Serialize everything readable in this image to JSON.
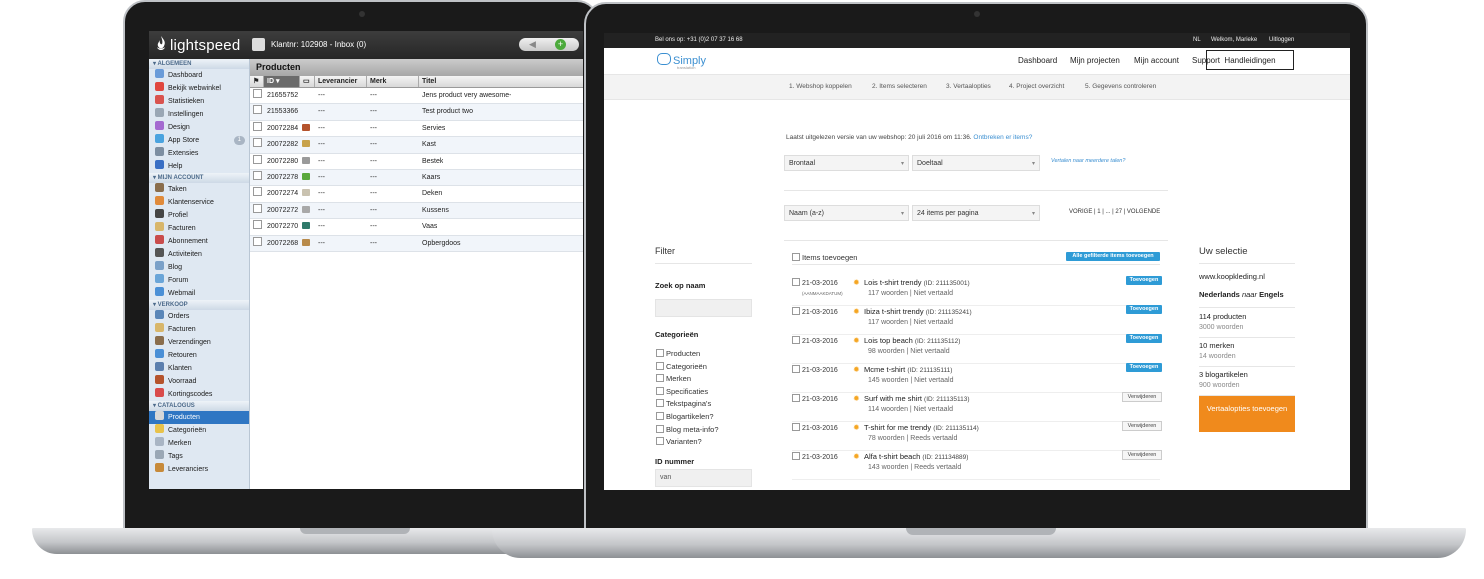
{
  "left": {
    "brand": "lightspeed",
    "client": "Klantnr: 102908 - Inbox (0)",
    "sections": [
      {
        "title": "ALGEMEEN",
        "items": [
          {
            "label": "Dashboard",
            "color": "#6a9bd8"
          },
          {
            "label": "Bekijk webwinkel",
            "color": "#e0473f"
          },
          {
            "label": "Statistieken",
            "color": "#d9534f"
          },
          {
            "label": "Instellingen",
            "color": "#9aa7b5"
          },
          {
            "label": "Design",
            "color": "#a46ad0"
          },
          {
            "label": "App Store",
            "color": "#4aa3df",
            "badge": "1"
          },
          {
            "label": "Extensies",
            "color": "#7d8ea1"
          },
          {
            "label": "Help",
            "color": "#3a6fc4"
          }
        ]
      },
      {
        "title": "MIJN ACCOUNT",
        "items": [
          {
            "label": "Taken",
            "color": "#8a6d4c"
          },
          {
            "label": "Klantenservice",
            "color": "#e08a3a"
          },
          {
            "label": "Profiel",
            "color": "#444444"
          },
          {
            "label": "Facturen",
            "color": "#d8b66a"
          },
          {
            "label": "Abonnement",
            "color": "#c94c4c"
          },
          {
            "label": "Activiteiten",
            "color": "#555555"
          },
          {
            "label": "Blog",
            "color": "#7aa0c8"
          },
          {
            "label": "Forum",
            "color": "#6aa5d8"
          },
          {
            "label": "Webmail",
            "color": "#4a8fd6"
          }
        ]
      },
      {
        "title": "VERKOOP",
        "items": [
          {
            "label": "Orders",
            "color": "#5a86b8"
          },
          {
            "label": "Facturen",
            "color": "#d8b66a"
          },
          {
            "label": "Verzendingen",
            "color": "#8a6d4c"
          },
          {
            "label": "Retouren",
            "color": "#4a8fd6"
          },
          {
            "label": "Klanten",
            "color": "#5c7fae"
          },
          {
            "label": "Voorraad",
            "color": "#b5532c"
          },
          {
            "label": "Kortingscodes",
            "color": "#d94b4b"
          }
        ]
      },
      {
        "title": "CATALOGUS",
        "items": [
          {
            "label": "Producten",
            "color": "#d8d8d8",
            "active": true
          },
          {
            "label": "Categorieën",
            "color": "#e8c24a"
          },
          {
            "label": "Merken",
            "color": "#a9b5c4"
          },
          {
            "label": "Tags",
            "color": "#9aa7b5"
          },
          {
            "label": "Leveranciers",
            "color": "#c78a3a"
          }
        ]
      }
    ],
    "panel_title": "Producten",
    "columns": [
      "ID",
      "Leverancier",
      "Merk",
      "Titel"
    ],
    "rows": [
      {
        "id": "21655752",
        "leverancier": "---",
        "merk": "---",
        "titel": "Jens product very awesome-",
        "thumb": ""
      },
      {
        "id": "21553366",
        "leverancier": "---",
        "merk": "---",
        "titel": "Test product two",
        "thumb": ""
      },
      {
        "id": "20072284",
        "leverancier": "---",
        "merk": "---",
        "titel": "Servies",
        "thumb": "#b5532c"
      },
      {
        "id": "20072282",
        "leverancier": "---",
        "merk": "---",
        "titel": "Kast",
        "thumb": "#c8a24a"
      },
      {
        "id": "20072280",
        "leverancier": "---",
        "merk": "---",
        "titel": "Bestek",
        "thumb": "#9a9a9a"
      },
      {
        "id": "20072278",
        "leverancier": "---",
        "merk": "---",
        "titel": "Kaars",
        "thumb": "#5aa83c"
      },
      {
        "id": "20072274",
        "leverancier": "---",
        "merk": "---",
        "titel": "Deken",
        "thumb": "#c9c2b0"
      },
      {
        "id": "20072272",
        "leverancier": "---",
        "merk": "---",
        "titel": "Kussens",
        "thumb": "#a8a8a8"
      },
      {
        "id": "20072270",
        "leverancier": "---",
        "merk": "---",
        "titel": "Vaas",
        "thumb": "#2f7a6a"
      },
      {
        "id": "20072268",
        "leverancier": "---",
        "merk": "---",
        "titel": "Opbergdoos",
        "thumb": "#b88a4a"
      }
    ]
  },
  "right": {
    "phone": "Bel ons op: +31 (0)2 07 37 16 68",
    "lang": "NL",
    "welcome": "Welkom, Marieke",
    "logout": "Uitloggen",
    "brand": "Simply",
    "brand_tag": "translation",
    "menu": [
      "Dashboard",
      "Mijn projecten",
      "Mijn account",
      "Support"
    ],
    "menu_button": "Handleidingen",
    "steps": [
      "1. Webshop koppelen",
      "2. Items selecteren",
      "3. Vertaalopties",
      "4. Project overzicht",
      "5. Gegevens controleren"
    ],
    "info_text": "Laatst uitgelezen versie van uw webshop: 20 juli 2016 om 11:36.",
    "info_link": "Ontbreken er items?",
    "source_lang": "Brontaal",
    "target_lang": "Doeltaal",
    "more_langs": "Vertalen naar meerdere talen?",
    "sort": "Naam (a-z)",
    "per_page": "24 items per pagina",
    "pagination": "VORIGE | 1 | ... | 27 | VOLGENDE",
    "filter_title": "Filter",
    "search_label": "Zoek op naam",
    "search_value": "",
    "categories_label": "Categorieën",
    "categories": [
      "Producten",
      "Categorieën",
      "Merken",
      "Specificaties",
      "Tekstpagina's",
      "Blogartikelen?",
      "Blog meta-info?",
      "Varianten?"
    ],
    "id_label": "ID nummer",
    "id_value": "van",
    "list_head": "Items toevoegen",
    "add_all": "Alle gefilterde items toevoegen",
    "items": [
      {
        "date": "21-03-2016",
        "sub": "(AANMAAKDATUM)",
        "name": "Lois t-shirt trendy",
        "id": "(ID: 211135001)",
        "meta": "117 woorden | Niet vertaald",
        "action": "Toevoegen",
        "kind": "add"
      },
      {
        "date": "21-03-2016",
        "sub": "",
        "name": "Ibiza t-shirt trendy",
        "id": "(ID: 211135241)",
        "meta": "117 woorden | Niet vertaald",
        "action": "Toevoegen",
        "kind": "add"
      },
      {
        "date": "21-03-2016",
        "sub": "",
        "name": "Lois top beach",
        "id": "(ID: 211135112)",
        "meta": "98 woorden | Niet vertaald",
        "action": "Toevoegen",
        "kind": "add"
      },
      {
        "date": "21-03-2016",
        "sub": "",
        "name": "Mcme t-shirt",
        "id": "(ID: 211135111)",
        "meta": "145 woorden | Niet vertaald",
        "action": "Toevoegen",
        "kind": "add"
      },
      {
        "date": "21-03-2016",
        "sub": "",
        "name": "Surf with me shirt",
        "id": "(ID: 211135113)",
        "meta": "114 woorden | Niet vertaald",
        "action": "Verwijderen",
        "kind": "remove"
      },
      {
        "date": "21-03-2016",
        "sub": "",
        "name": "T-shirt for me trendy",
        "id": "(ID: 211135114)",
        "meta": "78 woorden | Reeds vertaald",
        "action": "Verwijderen",
        "kind": "remove"
      },
      {
        "date": "21-03-2016",
        "sub": "",
        "name": "Alfa t-shirt beach",
        "id": "(ID: 211134889)",
        "meta": "143 woorden | Reeds vertaald",
        "action": "Verwijderen",
        "kind": "remove"
      }
    ],
    "selection_title": "Uw selectie",
    "selection_site": "www.koopkleding.nl",
    "selection_lang_from": "Nederlands",
    "selection_lang_word": "naar",
    "selection_lang_to": "Engels",
    "selection_groups": [
      {
        "label": "114 producten",
        "sub": "3000 woorden"
      },
      {
        "label": "10 merken",
        "sub": "14 woorden"
      },
      {
        "label": "3 blogartikelen",
        "sub": "900 woorden"
      }
    ],
    "cta": "Vertaalopties toevoegen"
  }
}
